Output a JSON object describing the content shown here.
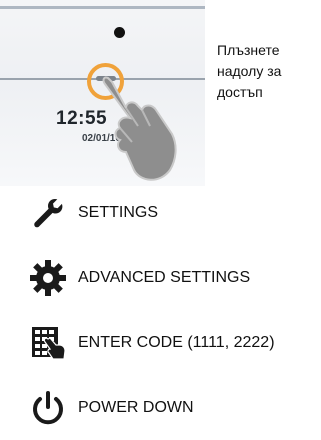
{
  "device_screen": {
    "clock": "12:55",
    "date": "02/01/16"
  },
  "swipe_hint": "Плъзнете надолу за достъп",
  "menu": {
    "settings": {
      "label": "SETTINGS",
      "icon": "wrench-icon"
    },
    "advanced_settings": {
      "label": "ADVANCED SETTINGS",
      "icon": "gear-icon"
    },
    "enter_code": {
      "label": "ENTER CODE (1111, 2222)",
      "icon": "keypad-hand-icon"
    },
    "power_down": {
      "label": "POWER DOWN",
      "icon": "power-icon"
    }
  },
  "colors": {
    "accent_orange": "#f0a23a",
    "icon_black": "#1a1a1a"
  }
}
